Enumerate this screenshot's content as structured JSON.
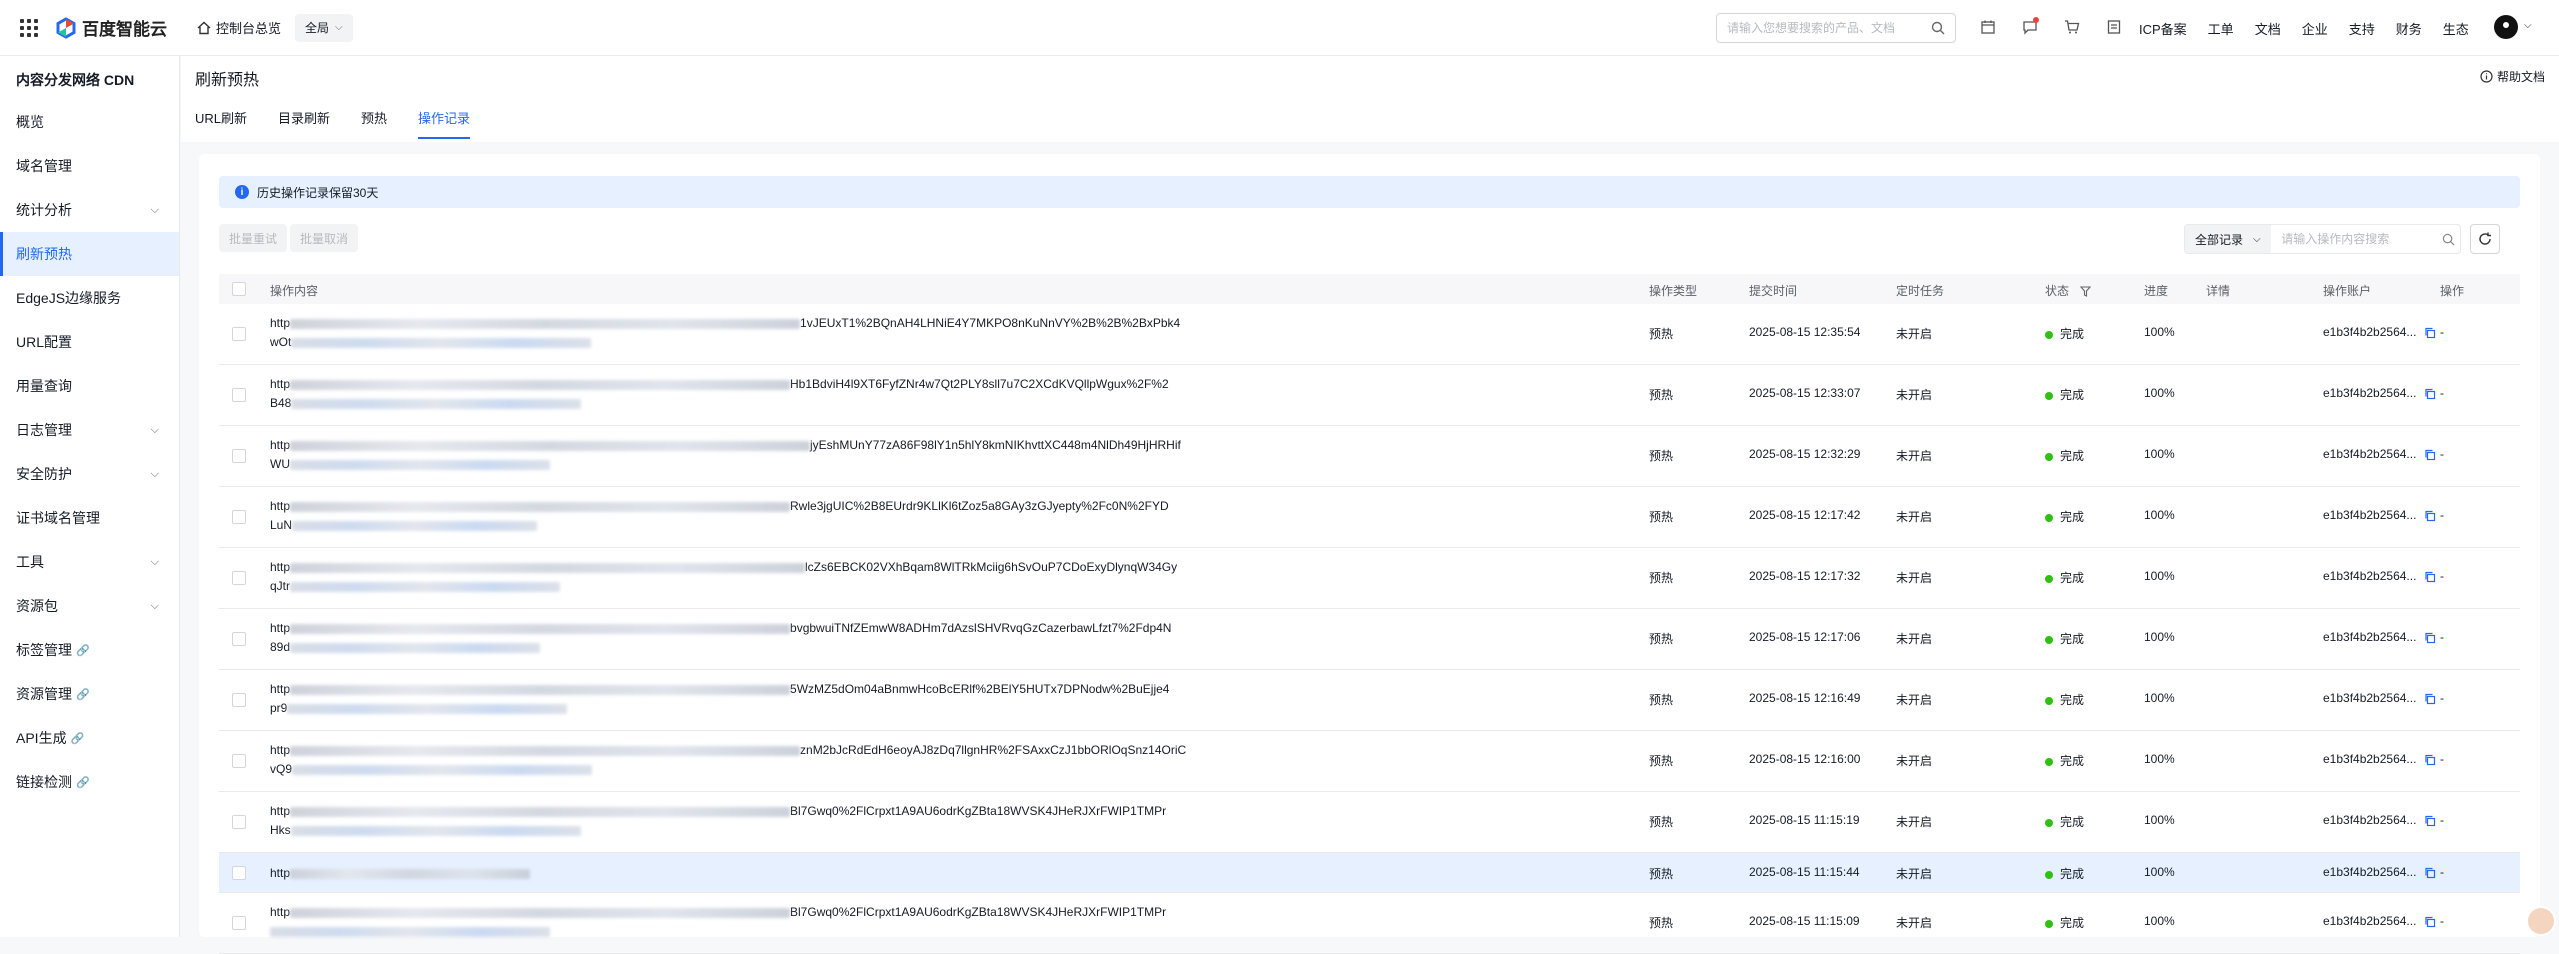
{
  "topbar": {
    "logo_text": "百度智能云",
    "home_label": "控制台总览",
    "region": "全局",
    "search_placeholder": "请输入您想要搜索的产品、文档",
    "links": [
      "ICP备案",
      "工单",
      "文档",
      "企业",
      "支持",
      "财务",
      "生态"
    ]
  },
  "sidebar": {
    "title": "内容分发网络 CDN",
    "items": [
      {
        "label": "概览"
      },
      {
        "label": "域名管理"
      },
      {
        "label": "统计分析"
      },
      {
        "label": "刷新预热"
      },
      {
        "label": "EdgeJS边缘服务"
      },
      {
        "label": "URL配置"
      },
      {
        "label": "用量查询"
      },
      {
        "label": "日志管理"
      },
      {
        "label": "安全防护"
      },
      {
        "label": "证书域名管理"
      },
      {
        "label": "工具"
      },
      {
        "label": "资源包"
      },
      {
        "label": "标签管理"
      },
      {
        "label": "资源管理"
      },
      {
        "label": "API生成"
      },
      {
        "label": "链接检测"
      }
    ]
  },
  "page": {
    "title": "刷新预热",
    "help": "帮助文档",
    "tabs": [
      "URL刷新",
      "目录刷新",
      "预热",
      "操作记录"
    ]
  },
  "notice": "历史操作记录保留30天",
  "buttons": {
    "retry": "批量重试",
    "cancel": "批量取消"
  },
  "filter": {
    "select": "全部记录",
    "placeholder": "请输入操作内容搜索"
  },
  "table": {
    "headers": [
      "操作内容",
      "操作类型",
      "提交时间",
      "定时任务",
      "状态",
      "进度",
      "详情",
      "操作账户",
      "操作"
    ],
    "rows": [
      {
        "prefix": "http",
        "tail1": "1vJEUxT1%2BQnAH4LHNiE4Y7MKPO8nKuNnVY%2B%2B%2BxPbk4",
        "prefix2": "wOt",
        "type": "预热",
        "time": "2025-08-15 12:35:54",
        "sched": "未开启",
        "status": "完成",
        "progress": "100%",
        "account": "e1b3f4b2b2564...",
        "op": "-"
      },
      {
        "prefix": "http",
        "tail1": "Hb1BdviH4l9XT6FyfZNr4w7Qt2PLY8sll7u7C2XCdKVQllpWgux%2F%2",
        "prefix2": "B48",
        "type": "预热",
        "time": "2025-08-15 12:33:07",
        "sched": "未开启",
        "status": "完成",
        "progress": "100%",
        "account": "e1b3f4b2b2564...",
        "op": "-"
      },
      {
        "prefix": "http",
        "tail1": "jyEshMUnY77zA86F98lY1n5hlY8kmNIKhvttXC448m4NlDh49HjHRHif",
        "prefix2": "WU",
        "type": "预热",
        "time": "2025-08-15 12:32:29",
        "sched": "未开启",
        "status": "完成",
        "progress": "100%",
        "account": "e1b3f4b2b2564...",
        "op": "-"
      },
      {
        "prefix": "http",
        "tail1": "Rwle3jgUIC%2B8EUrdr9KLlKl6tZoz5a8GAy3zGJyepty%2Fc0N%2FYD",
        "prefix2": "LuN",
        "type": "预热",
        "time": "2025-08-15 12:17:42",
        "sched": "未开启",
        "status": "完成",
        "progress": "100%",
        "account": "e1b3f4b2b2564...",
        "op": "-"
      },
      {
        "prefix": "http",
        "tail1": "lcZs6EBCK02VXhBqam8WlTRkMciig6hSvOuP7CDoExyDlynqW34Gy",
        "prefix2": "qJtr",
        "type": "预热",
        "time": "2025-08-15 12:17:32",
        "sched": "未开启",
        "status": "完成",
        "progress": "100%",
        "account": "e1b3f4b2b2564...",
        "op": "-"
      },
      {
        "prefix": "http",
        "tail1": "bvgbwuiTNfZEmwW8ADHm7dAzslSHVRvqGzCazerbawLfzt7%2Fdp4N",
        "prefix2": "89d",
        "type": "预热",
        "time": "2025-08-15 12:17:06",
        "sched": "未开启",
        "status": "完成",
        "progress": "100%",
        "account": "e1b3f4b2b2564...",
        "op": "-"
      },
      {
        "prefix": "http",
        "tail1": "5WzMZ5dOm04aBnmwHcoBcERlf%2BElY5HUTx7DPNodw%2BuEjje4",
        "prefix2": "pr9",
        "type": "预热",
        "time": "2025-08-15 12:16:49",
        "sched": "未开启",
        "status": "完成",
        "progress": "100%",
        "account": "e1b3f4b2b2564...",
        "op": "-"
      },
      {
        "prefix": "http",
        "tail1": "znM2bJcRdEdH6eoyAJ8zDq7llgnHR%2FSAxxCzJ1bbORlOqSnz14OriC",
        "prefix2": "vQ9",
        "type": "预热",
        "time": "2025-08-15 12:16:00",
        "sched": "未开启",
        "status": "完成",
        "progress": "100%",
        "account": "e1b3f4b2b2564...",
        "op": "-"
      },
      {
        "prefix": "http",
        "tail1": "Bl7Gwq0%2FlCrpxt1A9AU6odrKgZBta18WVSK4JHeRJXrFWIP1TMPr",
        "prefix2": "Hks",
        "type": "预热",
        "time": "2025-08-15 11:15:19",
        "sched": "未开启",
        "status": "完成",
        "progress": "100%",
        "account": "e1b3f4b2b2564...",
        "op": "-"
      },
      {
        "prefix": "http",
        "tail1": "",
        "prefix2": "",
        "type": "预热",
        "time": "2025-08-15 11:15:44",
        "sched": "未开启",
        "status": "完成",
        "progress": "100%",
        "account": "e1b3f4b2b2564...",
        "op": "-",
        "highlight": true
      },
      {
        "prefix": "http",
        "tail1": "Bl7Gwq0%2FlCrpxt1A9AU6odrKgZBta18WVSK4JHeRJXrFWIP1TMPr",
        "prefix2": "",
        "type": "预热",
        "time": "2025-08-15 11:15:09",
        "sched": "未开启",
        "status": "完成",
        "progress": "100%",
        "account": "e1b3f4b2b2564...",
        "op": "-"
      }
    ]
  },
  "colors": {
    "accent": "#2468f2",
    "success": "#30bf13",
    "highlight_row": "#e6f0ff"
  }
}
